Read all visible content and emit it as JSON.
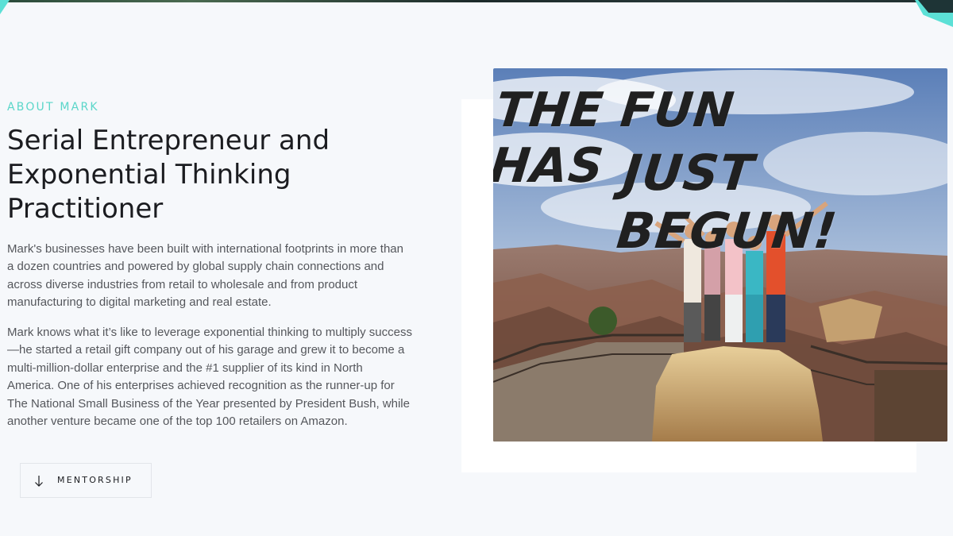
{
  "about": {
    "eyebrow": "ABOUT MARK",
    "headline": "Serial Entrepreneur and Exponential Thinking Practitioner",
    "paragraphs": [
      "Mark's businesses have been built with international footprints in more than a dozen countries and powered by global supply chain connections and across diverse industries from retail to wholesale and from product manufacturing to digital marketing and real estate.",
      "Mark knows what it’s like to leverage exponential thinking to multiply success—he started a retail gift company out of his garage and grew it to become a multi-million-dollar enterprise and the #1 supplier of its kind in North America. One of his enterprises achieved recognition as the runner-up for The National Small Business of the Year presented by President Bush, while another venture became one of the top 100 retailers on Amazon."
    ],
    "button_label": "MENTORSHIP",
    "button_icon": "arrow-down-icon"
  },
  "photo": {
    "caption_line_1": "THE FUN HAS",
    "caption_line_2": "JUST BEGUN!"
  },
  "colors": {
    "accent": "#5ad6c9",
    "background": "#f6f8fb",
    "heading": "#1b1c20",
    "body_text": "#55575c"
  }
}
